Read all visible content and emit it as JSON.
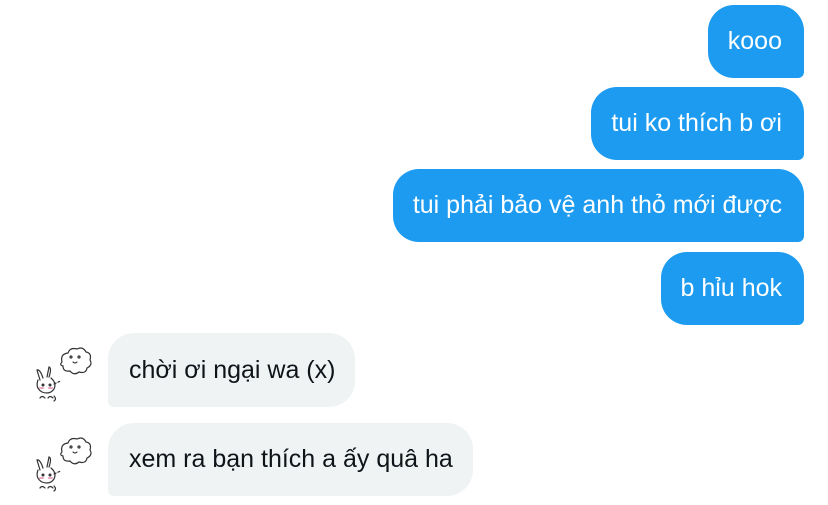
{
  "conversation": {
    "messages": [
      {
        "direction": "sent",
        "text": "kooo"
      },
      {
        "direction": "sent",
        "text": "tui ko thích b ơi"
      },
      {
        "direction": "sent",
        "text": "tui phải bảo vệ anh thỏ mới được"
      },
      {
        "direction": "sent",
        "text": "b hỉu hok"
      },
      {
        "direction": "received",
        "text": "chời ơi ngại wa (x)"
      },
      {
        "direction": "received",
        "text": "xem ra bạn thích a ấy quâ ha"
      }
    ]
  },
  "colors": {
    "sent_bubble": "#1d9bf0",
    "received_bubble": "#eff3f4",
    "sent_text": "#ffffff",
    "received_text": "#0f1419"
  },
  "icons": {
    "avatar": "bunny-sketch-avatar-icon"
  }
}
